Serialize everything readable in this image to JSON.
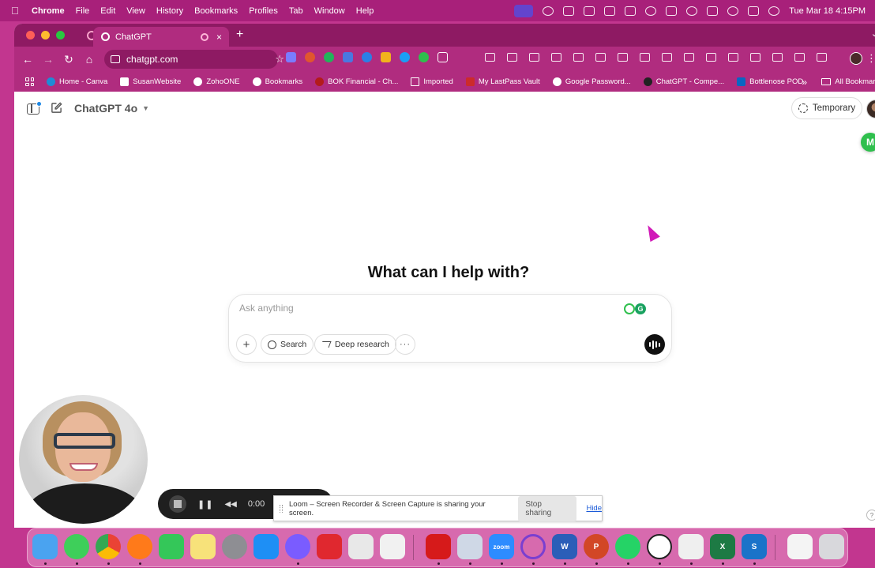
{
  "menubar": {
    "apple": "",
    "app": "Chrome",
    "items": [
      "File",
      "Edit",
      "View",
      "History",
      "Bookmarks",
      "Profiles",
      "Tab",
      "Window",
      "Help"
    ],
    "clock": "Tue Mar 18  4:15PM"
  },
  "browser": {
    "tab_title": "ChatGPT",
    "new_tab": "+",
    "url": "chatgpt.com",
    "bookmarks": [
      {
        "label": "Home - Canva",
        "color": "#1f8bd6"
      },
      {
        "label": "SusanWebsite",
        "color": "#ffffff"
      },
      {
        "label": "ZohoONE",
        "color": "#ffffff"
      },
      {
        "label": "Bookmarks",
        "color": "#ffffff"
      },
      {
        "label": "BOK Financial - Ch...",
        "color": "#b31b1b"
      },
      {
        "label": "Imported",
        "color": "#ffffff"
      },
      {
        "label": "My LastPass Vault",
        "color": "#cc2b2b"
      },
      {
        "label": "Google Password...",
        "color": "#ffffff"
      },
      {
        "label": "ChatGPT - Compe...",
        "color": "#222222"
      },
      {
        "label": "Bottlenose POD",
        "color": "#0a66c2"
      }
    ],
    "more": "»",
    "all_bookmarks": "All Bookmarks"
  },
  "chatgpt": {
    "model": "ChatGPT 4o",
    "temporary": "Temporary",
    "headline": "What can I help with?",
    "placeholder": "Ask anything",
    "plus": "+",
    "search": "Search",
    "deep_research": "Deep research",
    "more": "···",
    "m_badge": "M"
  },
  "loom": {
    "time": "0:00",
    "message": "Loom – Screen Recorder & Screen Capture is sharing your screen.",
    "stop_sharing": "Stop sharing",
    "hide": "Hide"
  },
  "dock": {
    "apps": [
      {
        "name": "finder",
        "color": "#4aa3f0"
      },
      {
        "name": "messages",
        "color": "#3ecf5a"
      },
      {
        "name": "chrome",
        "color": "#e9e9e9"
      },
      {
        "name": "firefox",
        "color": "#ff7a1a"
      },
      {
        "name": "facetime",
        "color": "#34c759"
      },
      {
        "name": "notes",
        "color": "#f7e27a"
      },
      {
        "name": "settings",
        "color": "#8e8e93"
      },
      {
        "name": "app-store",
        "color": "#1e8ff5"
      },
      {
        "name": "messenger",
        "color": "#7a5cff"
      },
      {
        "name": "quip",
        "color": "#e0282f"
      },
      {
        "name": "iphone-mirror",
        "color": "#e8e8e8"
      },
      {
        "name": "launchpad",
        "color": "#f1f1f1"
      },
      {
        "name": "acrobat",
        "color": "#d61a1a"
      },
      {
        "name": "preview",
        "color": "#cfd8e6"
      },
      {
        "name": "zoom",
        "color": "#2d8cff"
      },
      {
        "name": "screen-record",
        "color": "#7a3fd0"
      },
      {
        "name": "word",
        "color": "#2b5eb8"
      },
      {
        "name": "powerpoint",
        "color": "#d24726"
      },
      {
        "name": "whatsapp",
        "color": "#25d366"
      },
      {
        "name": "chatgpt",
        "color": "#ffffff"
      },
      {
        "name": "textedit",
        "color": "#efefef"
      },
      {
        "name": "excel",
        "color": "#1d7a44"
      },
      {
        "name": "s-app",
        "color": "#1a73c9"
      },
      {
        "name": "document",
        "color": "#f4f4f4"
      },
      {
        "name": "trash",
        "color": "#d8d8dc"
      }
    ]
  }
}
